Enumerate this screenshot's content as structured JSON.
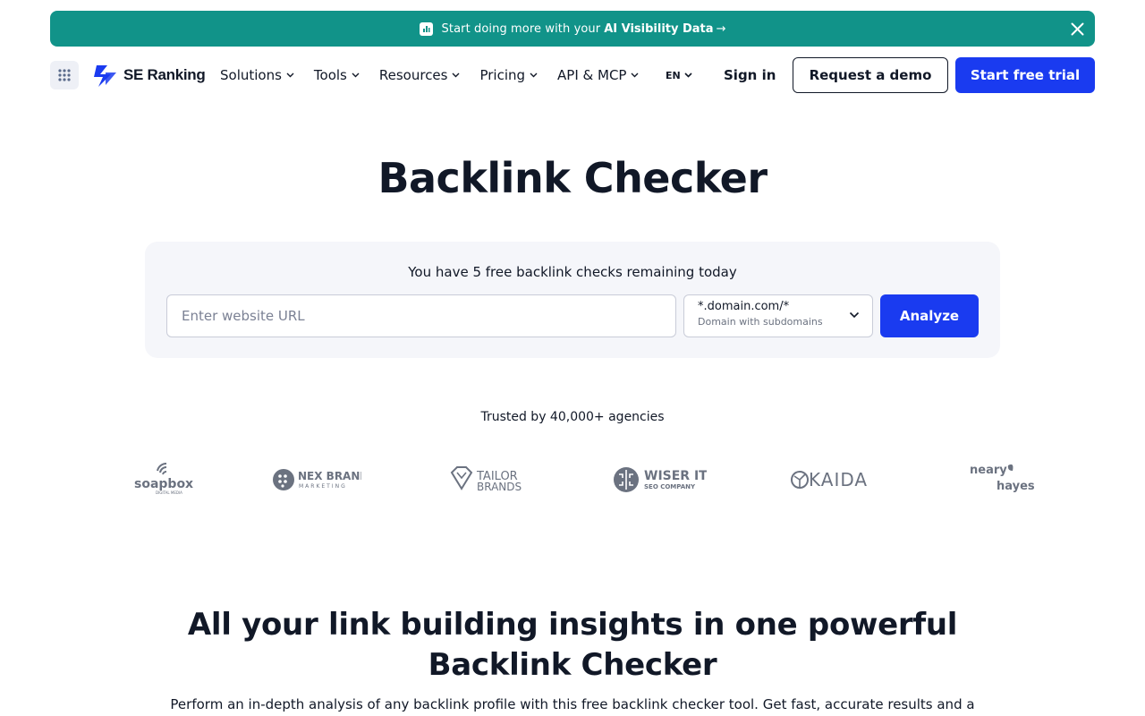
{
  "banner": {
    "text": "Start doing more with your",
    "highlight": "AI Visibility Data",
    "arrow": "→",
    "icon": "chart-box-icon",
    "close_icon": "close-icon"
  },
  "nav": {
    "brand": "SE Ranking",
    "menu": [
      {
        "label": "Solutions"
      },
      {
        "label": "Tools"
      },
      {
        "label": "Resources"
      },
      {
        "label": "Pricing"
      },
      {
        "label": "API & MCP"
      }
    ],
    "language": "EN",
    "sign_in": "Sign in",
    "request_demo": "Request a demo",
    "start_trial": "Start free trial"
  },
  "hero": {
    "title": "Backlink Checker",
    "remaining": "You have 5 free backlink checks remaining today",
    "url_placeholder": "Enter website URL",
    "scope_value": "*.domain.com/*",
    "scope_desc": "Domain with subdomains",
    "analyze": "Analyze"
  },
  "trusted": {
    "text": "Trusted by 40,000+ agencies",
    "logos": [
      {
        "name": "soapbox",
        "sub": "DIGITAL MEDIA"
      },
      {
        "name": "NEX BRAND",
        "sub": "MARKETING"
      },
      {
        "name": "TAILOR",
        "sub": "BRANDS"
      },
      {
        "name": "WISER IT",
        "sub": "SEO COMPANY"
      },
      {
        "name": "KAIDA",
        "sub": ""
      },
      {
        "name": "neary",
        "sub": "hayes"
      }
    ]
  },
  "section": {
    "title": "All your link building insights in one powerful Backlink Checker",
    "desc": "Perform an in-depth analysis of any backlink profile with this free backlink checker tool. Get fast, accurate results and a"
  },
  "colors": {
    "banner": "#119389",
    "primary": "#1a3bf0",
    "text": "#111827",
    "card": "#f5f6fa"
  }
}
